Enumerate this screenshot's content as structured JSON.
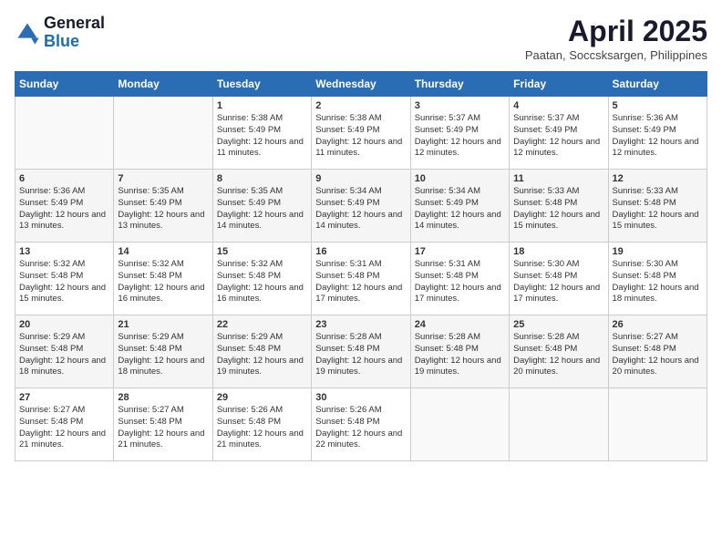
{
  "header": {
    "logo_general": "General",
    "logo_blue": "Blue",
    "month_title": "April 2025",
    "subtitle": "Paatan, Soccsksargen, Philippines"
  },
  "days_of_week": [
    "Sunday",
    "Monday",
    "Tuesday",
    "Wednesday",
    "Thursday",
    "Friday",
    "Saturday"
  ],
  "weeks": [
    [
      {
        "day": "",
        "info": ""
      },
      {
        "day": "",
        "info": ""
      },
      {
        "day": "1",
        "info": "Sunrise: 5:38 AM\nSunset: 5:49 PM\nDaylight: 12 hours and 11 minutes."
      },
      {
        "day": "2",
        "info": "Sunrise: 5:38 AM\nSunset: 5:49 PM\nDaylight: 12 hours and 11 minutes."
      },
      {
        "day": "3",
        "info": "Sunrise: 5:37 AM\nSunset: 5:49 PM\nDaylight: 12 hours and 12 minutes."
      },
      {
        "day": "4",
        "info": "Sunrise: 5:37 AM\nSunset: 5:49 PM\nDaylight: 12 hours and 12 minutes."
      },
      {
        "day": "5",
        "info": "Sunrise: 5:36 AM\nSunset: 5:49 PM\nDaylight: 12 hours and 12 minutes."
      }
    ],
    [
      {
        "day": "6",
        "info": "Sunrise: 5:36 AM\nSunset: 5:49 PM\nDaylight: 12 hours and 13 minutes."
      },
      {
        "day": "7",
        "info": "Sunrise: 5:35 AM\nSunset: 5:49 PM\nDaylight: 12 hours and 13 minutes."
      },
      {
        "day": "8",
        "info": "Sunrise: 5:35 AM\nSunset: 5:49 PM\nDaylight: 12 hours and 14 minutes."
      },
      {
        "day": "9",
        "info": "Sunrise: 5:34 AM\nSunset: 5:49 PM\nDaylight: 12 hours and 14 minutes."
      },
      {
        "day": "10",
        "info": "Sunrise: 5:34 AM\nSunset: 5:49 PM\nDaylight: 12 hours and 14 minutes."
      },
      {
        "day": "11",
        "info": "Sunrise: 5:33 AM\nSunset: 5:48 PM\nDaylight: 12 hours and 15 minutes."
      },
      {
        "day": "12",
        "info": "Sunrise: 5:33 AM\nSunset: 5:48 PM\nDaylight: 12 hours and 15 minutes."
      }
    ],
    [
      {
        "day": "13",
        "info": "Sunrise: 5:32 AM\nSunset: 5:48 PM\nDaylight: 12 hours and 15 minutes."
      },
      {
        "day": "14",
        "info": "Sunrise: 5:32 AM\nSunset: 5:48 PM\nDaylight: 12 hours and 16 minutes."
      },
      {
        "day": "15",
        "info": "Sunrise: 5:32 AM\nSunset: 5:48 PM\nDaylight: 12 hours and 16 minutes."
      },
      {
        "day": "16",
        "info": "Sunrise: 5:31 AM\nSunset: 5:48 PM\nDaylight: 12 hours and 17 minutes."
      },
      {
        "day": "17",
        "info": "Sunrise: 5:31 AM\nSunset: 5:48 PM\nDaylight: 12 hours and 17 minutes."
      },
      {
        "day": "18",
        "info": "Sunrise: 5:30 AM\nSunset: 5:48 PM\nDaylight: 12 hours and 17 minutes."
      },
      {
        "day": "19",
        "info": "Sunrise: 5:30 AM\nSunset: 5:48 PM\nDaylight: 12 hours and 18 minutes."
      }
    ],
    [
      {
        "day": "20",
        "info": "Sunrise: 5:29 AM\nSunset: 5:48 PM\nDaylight: 12 hours and 18 minutes."
      },
      {
        "day": "21",
        "info": "Sunrise: 5:29 AM\nSunset: 5:48 PM\nDaylight: 12 hours and 18 minutes."
      },
      {
        "day": "22",
        "info": "Sunrise: 5:29 AM\nSunset: 5:48 PM\nDaylight: 12 hours and 19 minutes."
      },
      {
        "day": "23",
        "info": "Sunrise: 5:28 AM\nSunset: 5:48 PM\nDaylight: 12 hours and 19 minutes."
      },
      {
        "day": "24",
        "info": "Sunrise: 5:28 AM\nSunset: 5:48 PM\nDaylight: 12 hours and 19 minutes."
      },
      {
        "day": "25",
        "info": "Sunrise: 5:28 AM\nSunset: 5:48 PM\nDaylight: 12 hours and 20 minutes."
      },
      {
        "day": "26",
        "info": "Sunrise: 5:27 AM\nSunset: 5:48 PM\nDaylight: 12 hours and 20 minutes."
      }
    ],
    [
      {
        "day": "27",
        "info": "Sunrise: 5:27 AM\nSunset: 5:48 PM\nDaylight: 12 hours and 21 minutes."
      },
      {
        "day": "28",
        "info": "Sunrise: 5:27 AM\nSunset: 5:48 PM\nDaylight: 12 hours and 21 minutes."
      },
      {
        "day": "29",
        "info": "Sunrise: 5:26 AM\nSunset: 5:48 PM\nDaylight: 12 hours and 21 minutes."
      },
      {
        "day": "30",
        "info": "Sunrise: 5:26 AM\nSunset: 5:48 PM\nDaylight: 12 hours and 22 minutes."
      },
      {
        "day": "",
        "info": ""
      },
      {
        "day": "",
        "info": ""
      },
      {
        "day": "",
        "info": ""
      }
    ]
  ]
}
